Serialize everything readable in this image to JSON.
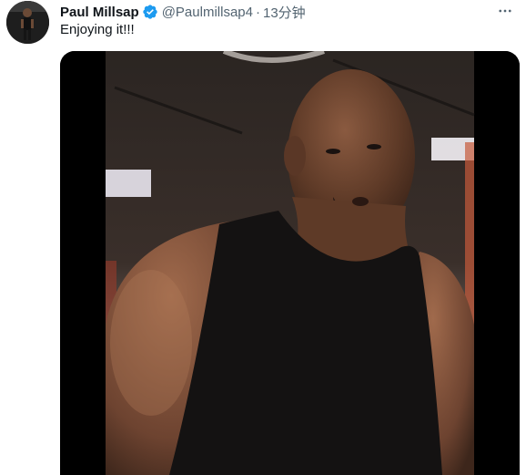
{
  "tweet": {
    "author_name": "Paul Millsap",
    "handle": "@Paulmillsap4",
    "separator": "·",
    "time": "13分钟",
    "text": "Enjoying it!!!",
    "more_icon": "more-horizontal-icon",
    "verified_icon": "verified-badge-icon"
  },
  "colors": {
    "verified_blue": "#1d9bf0",
    "secondary_text": "#536471",
    "primary_text": "#0f1419"
  }
}
